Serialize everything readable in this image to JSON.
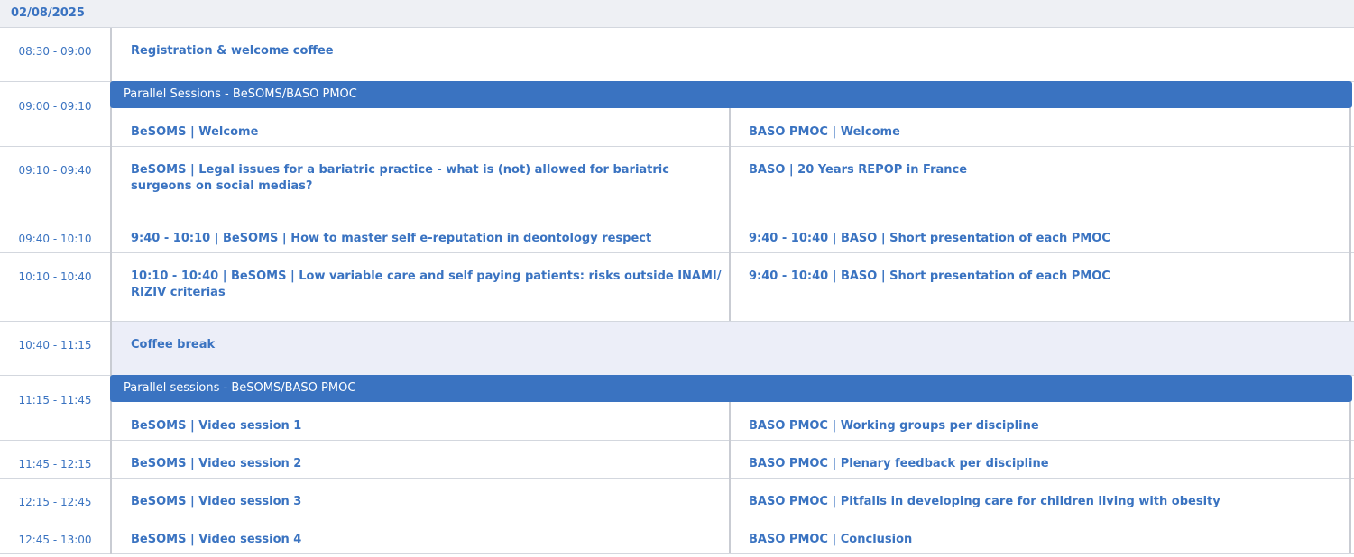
{
  "date": "02/08/2025",
  "times": [
    "08:30 - 09:00",
    "09:00 - 09:10",
    "09:10 - 09:40",
    "09:40 - 10:10",
    "10:10 - 10:40",
    "10:40 - 11:15",
    "11:15 - 11:45",
    "11:45 - 12:15",
    "12:15 - 12:45",
    "12:45 - 13:00"
  ],
  "registration": "Registration & welcome coffee",
  "banner1": "Parallel Sessions - BeSOMS/BASO PMOC",
  "banner2": "Parallel sessions - BeSOMS/BASO PMOC",
  "coffee_break": "Coffee break",
  "left": [
    "BeSOMS | Welcome",
    "BeSOMS | Legal issues for a bariatric practice - what is (not) allowed for bariatric surgeons on social medias?",
    "9:40 - 10:10 | BeSOMS | How to master self e-reputation in deontology respect",
    "10:10 - 10:40 | BeSOMS | Low variable care and self paying patients: risks outside INAMI/ RIZIV criterias",
    "BeSOMS | Video session 1",
    "BeSOMS | Video session 2",
    "BeSOMS | Video session 3",
    "BeSOMS | Video session 4"
  ],
  "right": [
    "BASO PMOC | Welcome",
    "BASO | 20 Years REPOP in France",
    "9:40 - 10:40 | BASO | Short presentation of each PMOC",
    "9:40 - 10:40 | BASO | Short presentation of each PMOC",
    "BASO PMOC | Working groups per discipline",
    "BASO PMOC | Plenary feedback per discipline",
    "BASO PMOC | Pitfalls in developing care for children living with obesity",
    "BASO PMOC | Conclusion"
  ],
  "colors": {
    "accent": "#3a73c1",
    "header_bg": "#eef0f4",
    "break_bg": "#eceef8"
  }
}
